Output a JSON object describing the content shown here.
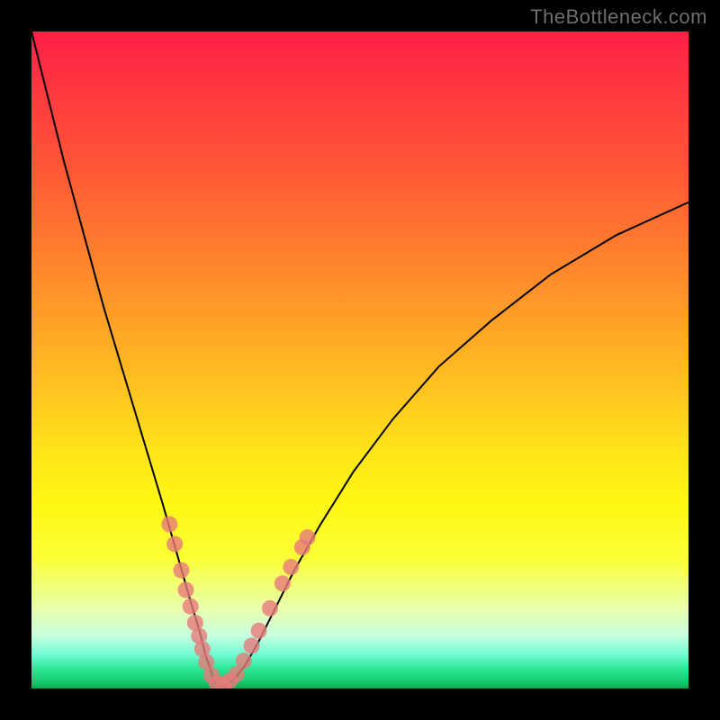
{
  "watermark": "TheBottleneck.com",
  "chart_data": {
    "type": "line",
    "title": "",
    "xlabel": "",
    "ylabel": "",
    "xlim": [
      0,
      100
    ],
    "ylim": [
      0,
      100
    ],
    "grid": false,
    "series": [
      {
        "name": "bottleneck-curve",
        "x": [
          0,
          2,
          5,
          8,
          11,
          14,
          17,
          20,
          22,
          24,
          25.5,
          26.5,
          27.2,
          27.8,
          28.3,
          29,
          30,
          31,
          32.5,
          34.5,
          37,
          40,
          44,
          49,
          55,
          62,
          70,
          79,
          89,
          100
        ],
        "y": [
          100,
          92,
          80,
          69,
          58,
          48,
          38,
          28,
          21,
          14,
          9,
          5,
          3,
          1.2,
          0.4,
          0.3,
          0.6,
          1.6,
          3.5,
          7,
          12,
          18,
          25,
          33,
          41,
          49,
          56,
          63,
          69,
          74
        ],
        "color": "#000000",
        "width": 2
      }
    ],
    "markers": {
      "name": "highlighted-points",
      "color": "#e77a7a",
      "radius": 9,
      "points": [
        {
          "x": 21.0,
          "y": 25.0
        },
        {
          "x": 21.8,
          "y": 22.0
        },
        {
          "x": 22.8,
          "y": 18.0
        },
        {
          "x": 23.5,
          "y": 15.0
        },
        {
          "x": 24.2,
          "y": 12.5
        },
        {
          "x": 24.9,
          "y": 10.0
        },
        {
          "x": 25.5,
          "y": 8.0
        },
        {
          "x": 26.0,
          "y": 6.0
        },
        {
          "x": 26.6,
          "y": 4.0
        },
        {
          "x": 27.4,
          "y": 2.0
        },
        {
          "x": 28.2,
          "y": 0.8
        },
        {
          "x": 29.2,
          "y": 0.6
        },
        {
          "x": 30.2,
          "y": 1.2
        },
        {
          "x": 31.2,
          "y": 2.2
        },
        {
          "x": 32.3,
          "y": 4.2
        },
        {
          "x": 33.5,
          "y": 6.5
        },
        {
          "x": 34.6,
          "y": 8.8
        },
        {
          "x": 36.3,
          "y": 12.2
        },
        {
          "x": 38.2,
          "y": 16.0
        },
        {
          "x": 39.5,
          "y": 18.5
        },
        {
          "x": 41.2,
          "y": 21.5
        },
        {
          "x": 42.0,
          "y": 23.0
        }
      ]
    },
    "background": {
      "type": "vertical-gradient",
      "stops": [
        {
          "pos": 0,
          "color": "#ff1f46"
        },
        {
          "pos": 100,
          "color": "#0da84e"
        }
      ]
    }
  }
}
